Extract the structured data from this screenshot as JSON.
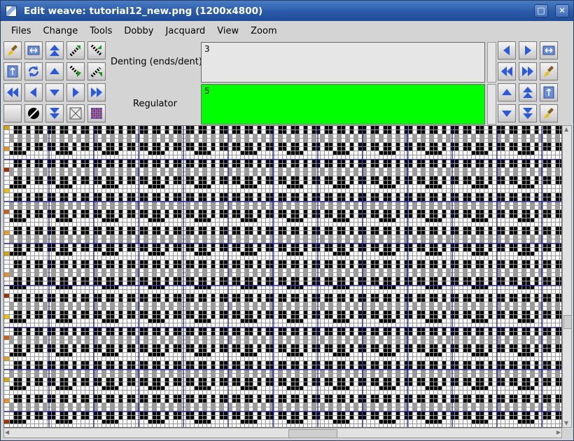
{
  "window": {
    "title": "Edit weave: tutorial12_new.png (1200x4800)",
    "maximize_glyph": "□",
    "close_glyph": "✕"
  },
  "menu": [
    "Files",
    "Change",
    "Tools",
    "Dobby",
    "Jacquard",
    "View",
    "Zoom"
  ],
  "fields": {
    "denting_label": "Denting (ends/dent)",
    "denting_value": "3",
    "regulator_label": "Regulator",
    "regulator_value": "5"
  },
  "colors": {
    "title_bar": "#2a5aa8",
    "regulator_bg": "#00ff00",
    "grid_line": "#1010a0",
    "arrow_blue": "#2a5ad8"
  },
  "tools_left": [
    "brush-icon",
    "fit-width-icon",
    "move-up-fast-icon",
    "shift-diagonal-up-icon",
    "shift-diagonal-inward-icon",
    "fit-height-icon",
    "rotate-icon",
    "triangle-up-icon",
    "shift-diagonal-down-icon",
    "shift-diagonal-reverse-icon",
    "fast-left-icon",
    "arrow-left-icon",
    "arrow-down-icon",
    "arrow-right-icon",
    "fast-right-icon",
    "refresh-icon",
    "invert-icon",
    "move-down-fast-icon",
    "clear-icon",
    "pattern-icon"
  ],
  "tools_right": [
    "arrow-left-icon",
    "arrow-right-icon",
    "fit-width-icon",
    "fast-left-icon",
    "fast-right-icon",
    "brush-icon",
    "triangle-up-icon",
    "move-up-fast-icon",
    "fit-height-icon",
    "arrow-down-icon",
    "move-down-fast-icon",
    "brush-icon"
  ]
}
